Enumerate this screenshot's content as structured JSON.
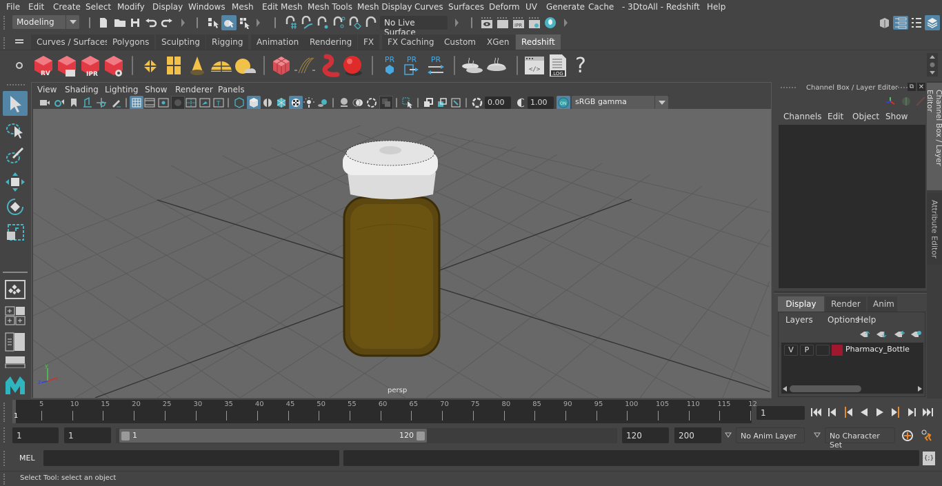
{
  "menubar": {
    "items": [
      "File",
      "Edit",
      "Create",
      "Select",
      "Modify",
      "Display",
      "Windows",
      "Mesh",
      "Edit Mesh",
      "Mesh Tools",
      "Mesh Display",
      "Curves",
      "Surfaces",
      "Deform",
      "UV",
      "Generate",
      "Cache",
      "- 3DtoAll -",
      "Redshift",
      "Help"
    ]
  },
  "statusline": {
    "workspace": "Modeling",
    "live_surface": "No Live Surface",
    "icons": [
      "new-scene",
      "open-scene",
      "save-scene",
      "undo",
      "redo",
      "select-by-hierarchy",
      "select-by-object",
      "select-by-component",
      "snap-to-grid",
      "snap-to-curve",
      "snap-to-point",
      "snap-to-view-plane",
      "snap-to-live",
      "magnet",
      "render-view",
      "render-current",
      "ipr-render",
      "render-settings",
      "hypershade"
    ]
  },
  "shelf": {
    "tabs": [
      "Curves / Surfaces",
      "Polygons",
      "Sculpting",
      "Rigging",
      "Animation",
      "Rendering",
      "FX",
      "FX Caching",
      "Custom",
      "XGen",
      "Redshift"
    ],
    "active_tab": "Redshift",
    "redshift_labels": {
      "rv": "RV",
      "ipr": "IPR",
      "pr": "PR",
      "log": ".LOG",
      "help": "?"
    }
  },
  "viewport": {
    "menu": [
      "View",
      "Shading",
      "Lighting",
      "Show",
      "Renderer",
      "Panels"
    ],
    "exposure": "0.00",
    "gamma": "1.00",
    "color_space": "sRGB gamma",
    "on_label": "ON",
    "camera_label": "persp",
    "axis": {
      "x": "x",
      "y": "y",
      "z": "z"
    },
    "object_colors": {
      "cap": "#e6e6e6",
      "bottle": "#6b5412"
    }
  },
  "channel_box": {
    "title": "Channel Box / Layer Editor",
    "menu": [
      "Channels",
      "Edit",
      "Object",
      "Show"
    ]
  },
  "layer_editor": {
    "tabs": [
      "Display",
      "Render",
      "Anim"
    ],
    "active_tab": "Display",
    "menu": [
      "Layers",
      "Options",
      "Help"
    ],
    "layers": [
      {
        "visible": "V",
        "playback": "P",
        "type": "",
        "color": "#a01830",
        "name": "Pharmacy_Bottle"
      }
    ]
  },
  "side_tabs": [
    "Channel Box / Layer Editor",
    "Attribute Editor"
  ],
  "timeline": {
    "ticks": [
      "5",
      "10",
      "15",
      "20",
      "25",
      "30",
      "35",
      "40",
      "45",
      "50",
      "55",
      "60",
      "65",
      "70",
      "75",
      "80",
      "85",
      "90",
      "95",
      "100",
      "105",
      "110",
      "115",
      "12"
    ],
    "current_frame_marker": "1",
    "current_frame": "1"
  },
  "range": {
    "start": "1",
    "anim_start": "1",
    "slider_start": "1",
    "slider_end": "120",
    "end": "120",
    "anim_end": "200",
    "anim_layer": "No Anim Layer",
    "character_set": "No Character Set"
  },
  "cmdline": {
    "label": "MEL"
  },
  "helpline": {
    "text": "Select Tool: select an object"
  }
}
